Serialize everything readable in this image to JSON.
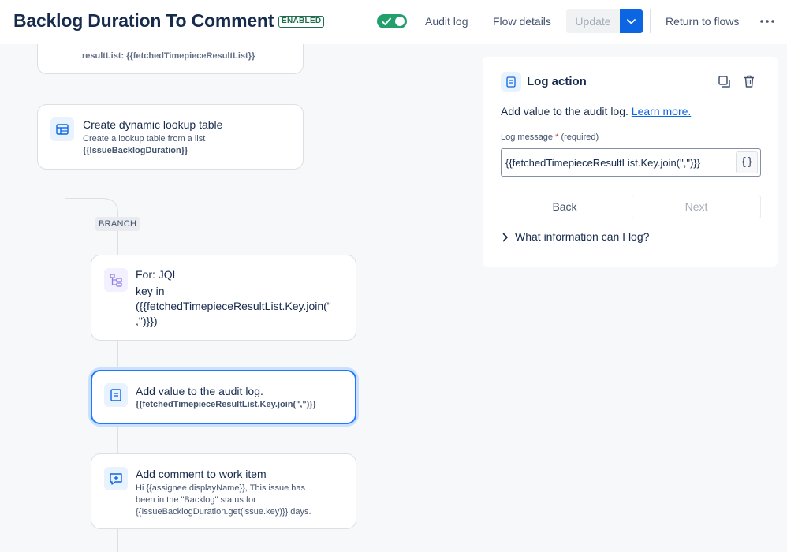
{
  "header": {
    "title": "Backlog Duration To Comment",
    "status_badge": "ENABLED",
    "audit_log_label": "Audit log",
    "flow_details_label": "Flow details",
    "update_label": "Update",
    "return_label": "Return to flows"
  },
  "flow": {
    "partial_card": {
      "text": "resultList: {{fetchedTimepieceResultList}}"
    },
    "lookup_card": {
      "title": "Create dynamic lookup table",
      "subtitle": "Create a lookup table from a list",
      "variable": "{{IssueBacklogDuration}}",
      "icon": "table-icon"
    },
    "branch_label": "BRANCH",
    "for_card": {
      "title": "For: JQL",
      "line1": "key in",
      "line2": "({{fetchedTimepieceResultList.Key.join(\"",
      "line3": ",\")}})",
      "icon": "branch-tree-icon"
    },
    "log_card": {
      "title": "Add value to the audit log.",
      "variable": "{{fetchedTimepieceResultList.Key.join(\",\")}}",
      "icon": "log-icon"
    },
    "comment_card": {
      "title": "Add comment to work item",
      "line1": "Hi {{assignee.displayName}}, This issue has",
      "line2": "been in the \"Backlog\" status for",
      "line3": "{{IssueBacklogDuration.get(issue.key)}} days.",
      "icon": "comment-add-icon"
    }
  },
  "panel": {
    "title": "Log action",
    "description": "Add value to the audit log.",
    "learn_more": "Learn more.",
    "field_label": "Log message",
    "required_mark": "*",
    "required_text": "(required)",
    "field_value": "{{fetchedTimepieceResultList.Key.join(\",\")}}",
    "brace_label": "{}",
    "back_label": "Back",
    "next_label": "Next",
    "info_label": "What information can I log?"
  },
  "colors": {
    "accent": "#0c66e4",
    "enabled_green": "#216e4e",
    "toggle_on": "#22a06b",
    "selected_border": "#1d7afc"
  }
}
